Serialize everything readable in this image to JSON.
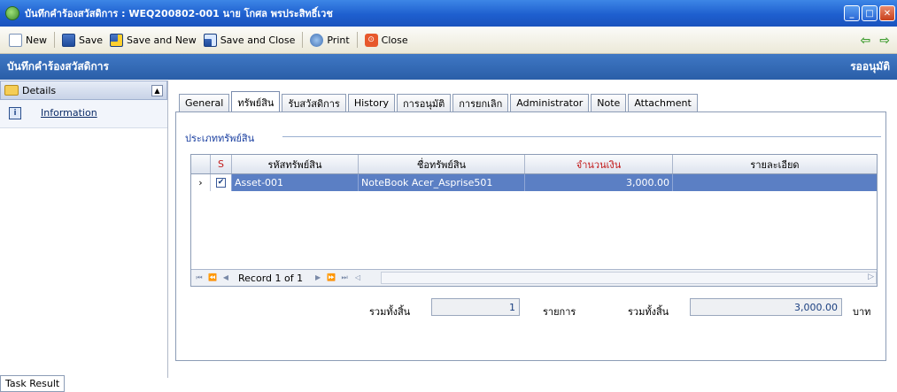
{
  "window": {
    "title": "บันทึกคำร้องสวัสดิการ : WEQ200802-001 นาย โกศล พรประสิทธิ์เวช",
    "controls": [
      "minimize",
      "maximize",
      "close"
    ]
  },
  "toolbar": {
    "new_label": "New",
    "save_label": "Save",
    "save_new_label": "Save and New",
    "save_close_label": "Save and Close",
    "print_label": "Print",
    "close_label": "Close"
  },
  "header": {
    "title": "บันทึกคำร้องสวัสดิการ",
    "status": "รออนุมัติ"
  },
  "sidebar": {
    "section_label": "Details",
    "items": [
      {
        "label": "Information",
        "icon": "info-icon"
      }
    ]
  },
  "tabs": [
    "General",
    "ทรัพย์สิน",
    "รับสวัสดิการ",
    "History",
    "การอนุมัติ",
    "การยกเลิก",
    "Administrator",
    "Note",
    "Attachment"
  ],
  "active_tab": "ทรัพย์สิน",
  "section": {
    "title": "ประเภททรัพย์สิน"
  },
  "grid": {
    "columns": [
      "S",
      "รหัสทรัพย์สิน",
      "ชื่อทรัพย์สิน",
      "จำนวนเงิน",
      "รายละเอียด"
    ],
    "rows": [
      {
        "selected": true,
        "checked": true,
        "code": "Asset-001",
        "name": "NoteBook Acer_Asprise501",
        "amount": "3,000.00",
        "detail": ""
      }
    ],
    "record_text": "Record 1 of 1"
  },
  "summary": {
    "count_label": "รวมทั้งสิ้น",
    "count_value": "1",
    "count_unit": "รายการ",
    "total_label": "รวมทั้งสิ้น",
    "total_value": "3,000.00",
    "total_unit": "บาท"
  },
  "taskbar": {
    "task_label": "Task Result"
  },
  "colors": {
    "titlebar": "#2a66d4",
    "header_band": "#2a5ea8",
    "row_selected": "#5b7fc4",
    "required_header": "#c21a1a"
  }
}
